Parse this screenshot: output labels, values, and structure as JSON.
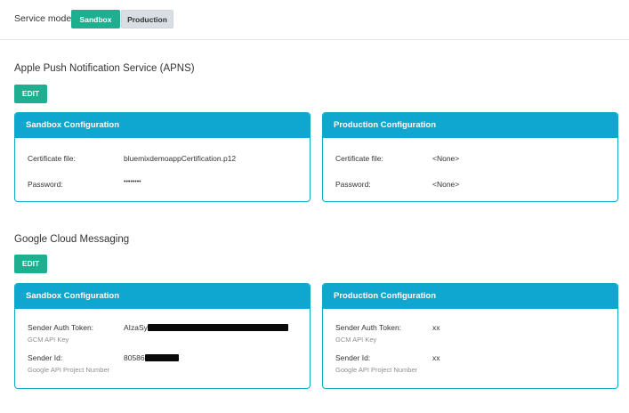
{
  "service_mode": {
    "label": "Service mode:",
    "options": [
      "Sandbox",
      "Production"
    ],
    "selected": "Sandbox"
  },
  "apns": {
    "title": "Apple Push Notification Service (APNS)",
    "edit_label": "EDIT",
    "sandbox": {
      "header": "Sandbox Configuration",
      "cert_label": "Certificate file:",
      "cert_value": "bluemixdemoappCertification.p12",
      "pass_label": "Password:",
      "pass_value": "••••••••"
    },
    "production": {
      "header": "Production Configuration",
      "cert_label": "Certificate file:",
      "cert_value": "<None>",
      "pass_label": "Password:",
      "pass_value": "<None>"
    }
  },
  "gcm": {
    "title": "Google Cloud Messaging",
    "edit_label": "EDIT",
    "sandbox": {
      "header": "Sandbox Configuration",
      "token_label": "Sender Auth Token:",
      "token_sub": "GCM API Key",
      "token_value_prefix": "AIzaSy",
      "id_label": "Sender Id:",
      "id_sub": "Google API Project Number",
      "id_value_prefix": "80586"
    },
    "production": {
      "header": "Production Configuration",
      "token_label": "Sender Auth Token:",
      "token_sub": "GCM API Key",
      "token_value": "xx",
      "id_label": "Sender Id:",
      "id_sub": "Google API Project Number",
      "id_value": "xx"
    }
  },
  "colors": {
    "accent_green": "#1daf8f",
    "card_header_blue": "#0fa7d0"
  }
}
